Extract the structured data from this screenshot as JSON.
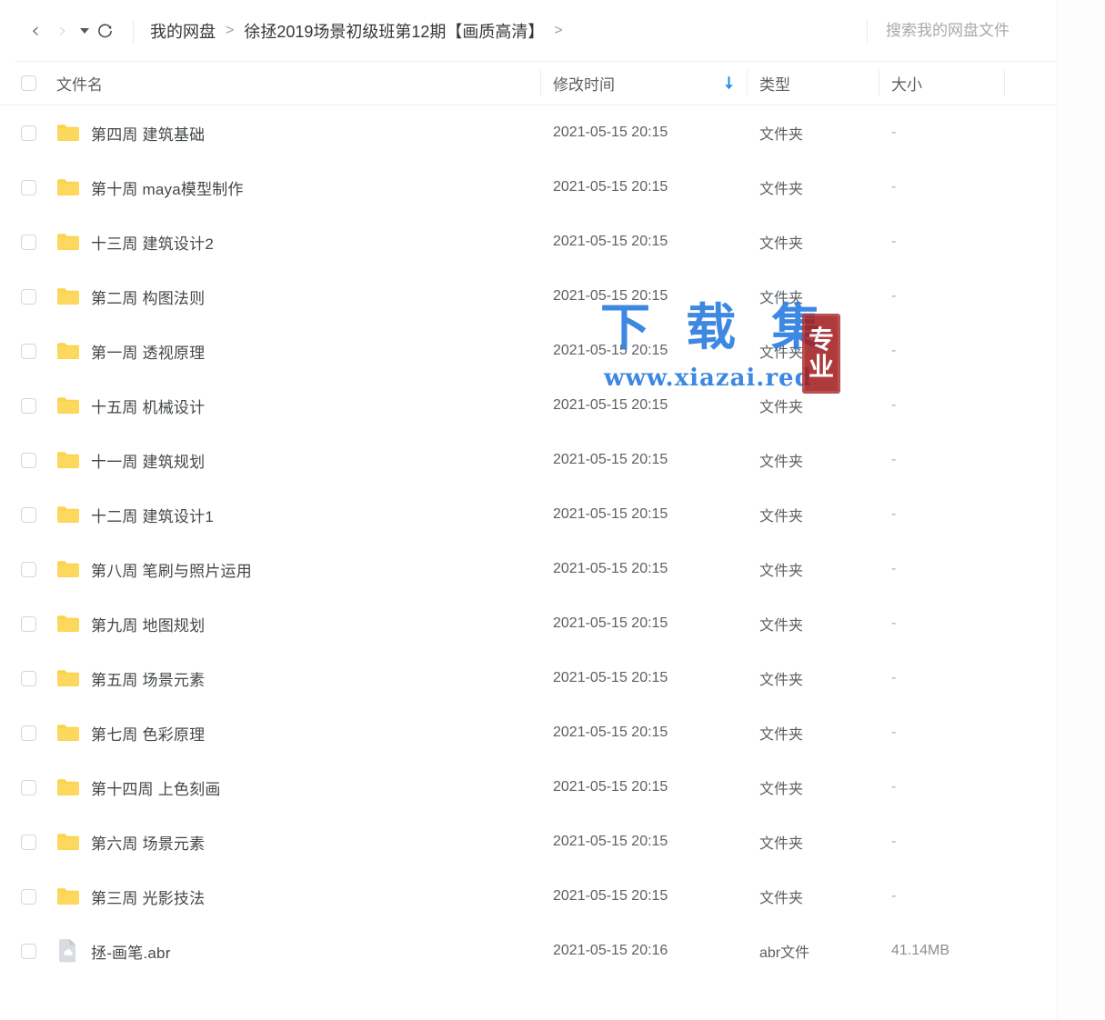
{
  "topbar": {
    "back_icon": "chevron-left-icon",
    "forward_icon": "chevron-right-icon",
    "history_caret_icon": "caret-down-icon",
    "refresh_icon": "refresh-icon",
    "breadcrumb": {
      "items": [
        "我的网盘",
        "徐拯2019场景初级班第12期【画质高清】"
      ],
      "separator": ">",
      "trailing_separator": ">"
    },
    "search": {
      "placeholder": "搜索我的网盘文件",
      "value": ""
    }
  },
  "table": {
    "columns": {
      "select_all": "",
      "name": "文件名",
      "time": "修改时间",
      "type": "类型",
      "size": "大小"
    },
    "sort": {
      "column": "修改时间",
      "direction": "desc",
      "arrow_icon": "arrow-down-icon",
      "arrow_color": "#2b8cf0"
    },
    "rows": [
      {
        "icon": "folder-icon",
        "name": "第四周  建筑基础",
        "time": "2021-05-15 20:15",
        "type": "文件夹",
        "size": "-"
      },
      {
        "icon": "folder-icon",
        "name": "第十周  maya模型制作",
        "time": "2021-05-15 20:15",
        "type": "文件夹",
        "size": "-"
      },
      {
        "icon": "folder-icon",
        "name": "十三周   建筑设计2",
        "time": "2021-05-15 20:15",
        "type": "文件夹",
        "size": "-"
      },
      {
        "icon": "folder-icon",
        "name": "第二周  构图法则",
        "time": "2021-05-15 20:15",
        "type": "文件夹",
        "size": "-"
      },
      {
        "icon": "folder-icon",
        "name": "第一周  透视原理",
        "time": "2021-05-15 20:15",
        "type": "文件夹",
        "size": "-"
      },
      {
        "icon": "folder-icon",
        "name": "十五周 机械设计",
        "time": "2021-05-15 20:15",
        "type": "文件夹",
        "size": "-"
      },
      {
        "icon": "folder-icon",
        "name": "十一周   建筑规划",
        "time": "2021-05-15 20:15",
        "type": "文件夹",
        "size": "-"
      },
      {
        "icon": "folder-icon",
        "name": "十二周   建筑设计1",
        "time": "2021-05-15 20:15",
        "type": "文件夹",
        "size": "-"
      },
      {
        "icon": "folder-icon",
        "name": "第八周  笔刷与照片运用",
        "time": "2021-05-15 20:15",
        "type": "文件夹",
        "size": "-"
      },
      {
        "icon": "folder-icon",
        "name": "第九周  地图规划",
        "time": "2021-05-15 20:15",
        "type": "文件夹",
        "size": "-"
      },
      {
        "icon": "folder-icon",
        "name": "第五周  场景元素",
        "time": "2021-05-15 20:15",
        "type": "文件夹",
        "size": "-"
      },
      {
        "icon": "folder-icon",
        "name": "第七周  色彩原理",
        "time": "2021-05-15 20:15",
        "type": "文件夹",
        "size": "-"
      },
      {
        "icon": "folder-icon",
        "name": "第十四周 上色刻画",
        "time": "2021-05-15 20:15",
        "type": "文件夹",
        "size": "-"
      },
      {
        "icon": "folder-icon",
        "name": "第六周  场景元素",
        "time": "2021-05-15 20:15",
        "type": "文件夹",
        "size": "-"
      },
      {
        "icon": "folder-icon",
        "name": "第三周  光影技法",
        "time": "2021-05-15 20:15",
        "type": "文件夹",
        "size": "-"
      },
      {
        "icon": "file-cloud-icon",
        "name": "拯-画笔.abr",
        "time": "2021-05-15 20:16",
        "type": "abr文件",
        "size": "41.14MB"
      }
    ]
  },
  "watermark": {
    "title": "下 载 集",
    "url": "www.xiazai.red",
    "seal_top": "专",
    "seal_bottom": "业",
    "color": "#2f7fe0",
    "seal_color": "#a51f20"
  },
  "theme": {
    "folder_color": "#fbd34d",
    "accent_blue": "#2b8cf0",
    "border": "#eef0f2"
  }
}
